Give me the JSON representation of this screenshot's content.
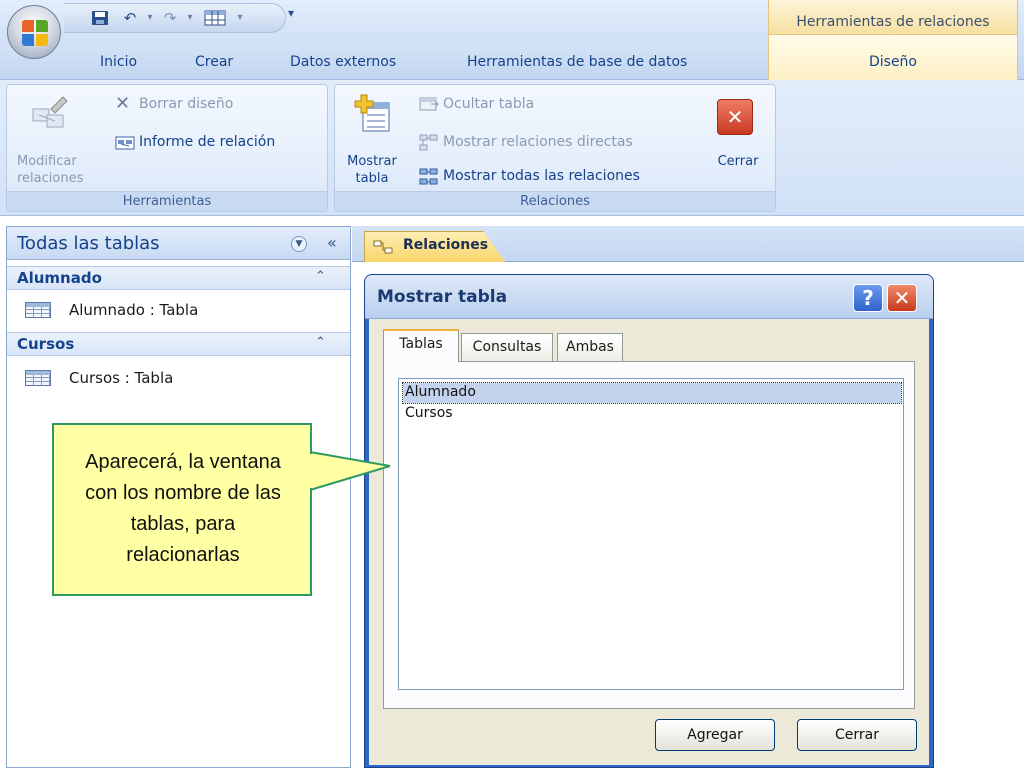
{
  "colors": {
    "ribbon_text": "#15428b",
    "contextual_header": "#f6dfa0",
    "dialog_frame": "#2f67c9",
    "callout_fill": "#ffffa4",
    "callout_border": "#2e9a62"
  },
  "title_bar": {
    "office_button_icon": "office-logo-icon",
    "quick_access": [
      "save-icon",
      "undo-icon",
      "redo-icon",
      "datasheet-view-icon"
    ],
    "contextual_group": "Herramientas de relaciones"
  },
  "tabs": {
    "inicio": "Inicio",
    "crear": "Crear",
    "datos_externos": "Datos externos",
    "herramientas_bd": "Herramientas de base de datos",
    "diseno": "Diseño"
  },
  "ribbon": {
    "herramientas": {
      "label": "Herramientas",
      "modificar_line1": "Modificar",
      "modificar_line2": "relaciones",
      "borrar": "Borrar diseño",
      "informe": "Informe de relación"
    },
    "relaciones": {
      "label": "Relaciones",
      "mostrar_line1": "Mostrar",
      "mostrar_line2": "tabla",
      "ocultar": "Ocultar tabla",
      "directas": "Mostrar relaciones directas",
      "todas": "Mostrar todas las relaciones",
      "cerrar": "Cerrar"
    }
  },
  "nav": {
    "title": "Todas las tablas",
    "collapse_glyph": "«",
    "groups": [
      {
        "label": "Alumnado",
        "item": "Alumnado : Tabla"
      },
      {
        "label": "Cursos",
        "item": "Cursos : Tabla"
      }
    ]
  },
  "document": {
    "tab_label": "Relaciones"
  },
  "dialog": {
    "title": "Mostrar tabla",
    "help_glyph": "?",
    "close_glyph": "✕",
    "tabs": [
      "Tablas",
      "Consultas",
      "Ambas"
    ],
    "active_tab": "Tablas",
    "tables": [
      "Alumnado",
      "Cursos"
    ],
    "selected_table": "Alumnado",
    "buttons": {
      "add": "Agregar",
      "close": "Cerrar"
    }
  },
  "callout": {
    "line1": "Aparecerá, la ventana",
    "line2": "con los nombre de las",
    "line3": "tablas, para",
    "line4": "relacionarlas"
  }
}
